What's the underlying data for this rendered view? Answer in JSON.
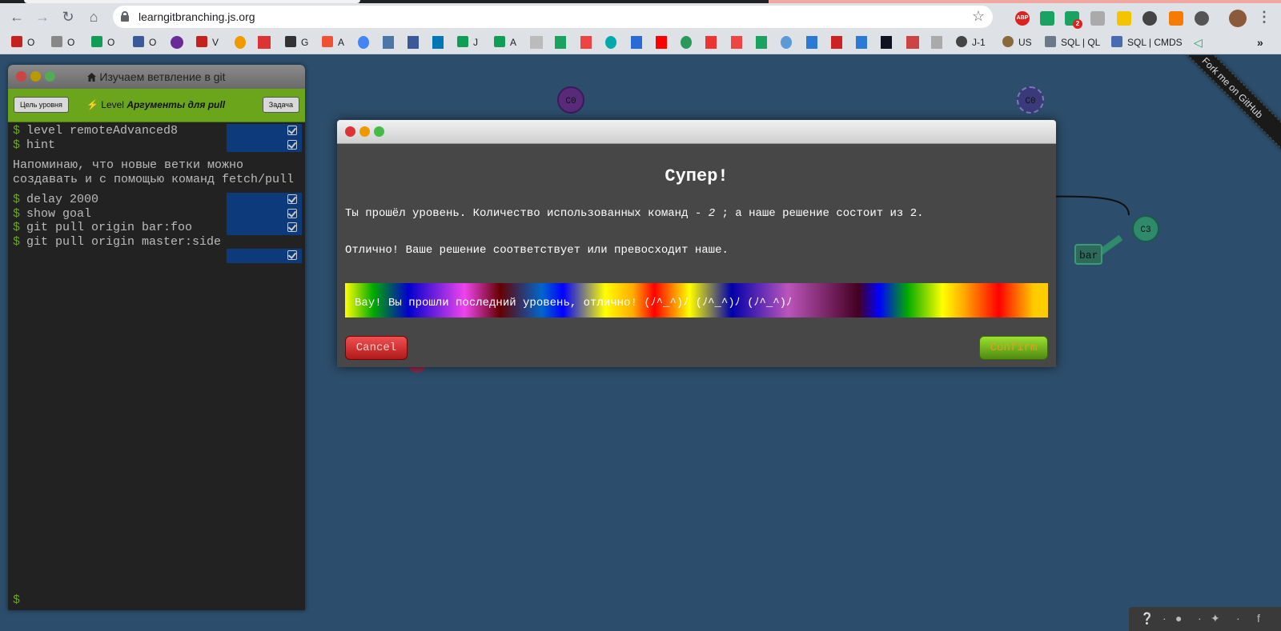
{
  "browser": {
    "url": "learngitbranching.js.org",
    "ext_badge_abp": "ABP",
    "ext_badge_count": "2",
    "more_bookmarks": "»"
  },
  "bookmarks": [
    "O",
    "O",
    "O",
    "O",
    "V",
    "G",
    "A",
    "J",
    "A",
    "J-1",
    "US",
    "SQL | QL",
    "SQL | CMDS"
  ],
  "terminal": {
    "title": "Изучаем ветвление в git",
    "goal_button": "Цель уровня",
    "task_button": "Задача",
    "level_prefix": "Level",
    "level_name": "Аргументы для pull",
    "prompt": "$",
    "commands1": [
      "level remoteAdvanced8",
      "hint"
    ],
    "message": "Напоминаю, что новые ветки можно создавать и с помощью команд fetch/pull",
    "commands2": [
      "delay 2000",
      "show goal",
      "git pull origin bar:foo",
      "git pull origin master:side"
    ]
  },
  "tree": {
    "nodes": [
      "C0",
      "C0",
      "C3"
    ],
    "branch": "bar"
  },
  "ribbon": "Fork me on GitHub",
  "dialog": {
    "heading": "Супер!",
    "line1_a": "Ты прошёл уровень. Количество использованных команд - ",
    "line1_count": "2",
    "line1_b": " ; а наше решение состоит из 2.",
    "line2": "Отлично! Ваше решение соответствует или превосходит наше.",
    "rainbow": "Вау! Вы прошли последний уровень, отлично! (ﾉ^_^)ﾉ (ﾉ^_^)ﾉ (ﾉ^_^)ﾉ",
    "cancel": "Cancel",
    "confirm": "Confirm"
  },
  "colors": {
    "background": "#2c4d6b",
    "terminal_bar": "#6aa51c",
    "node_c0": "#5a2a7a",
    "node_c3": "#2e8a6a"
  }
}
